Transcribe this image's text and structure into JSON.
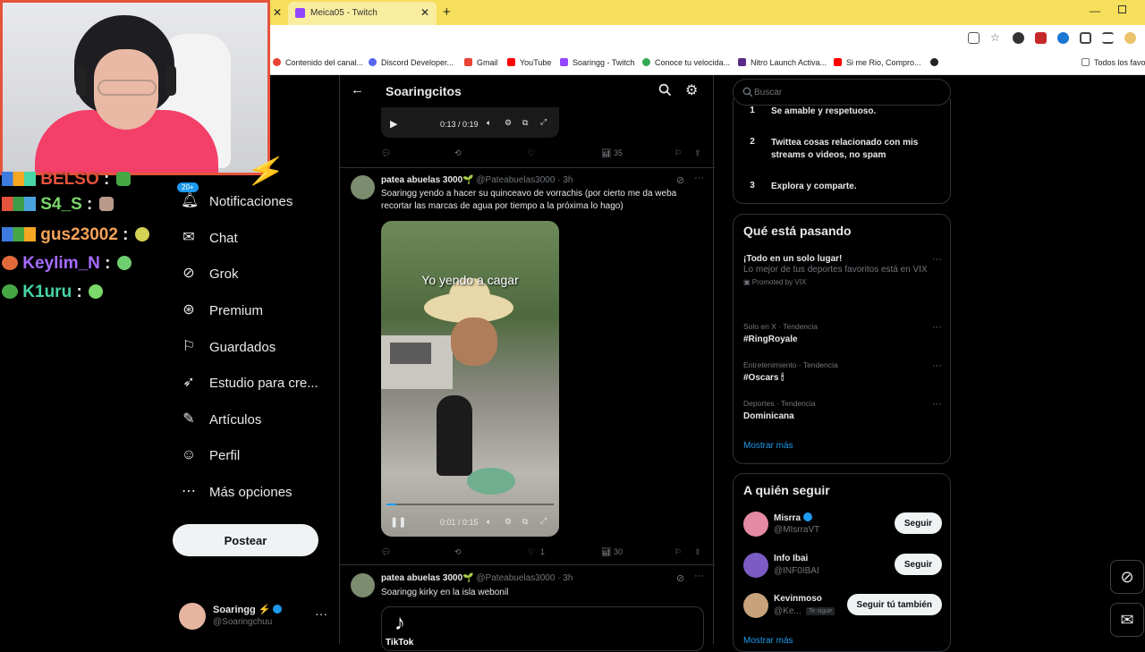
{
  "browser": {
    "tab_title": "Meica05 - Twitch",
    "bookmarks": [
      {
        "label": "Contenido del canal...",
        "color": "#ea4335"
      },
      {
        "label": "Discord Developer...",
        "color": "#5865f2"
      },
      {
        "label": "Gmail",
        "color": "#ea4335"
      },
      {
        "label": "YouTube",
        "color": "#ff0000"
      },
      {
        "label": "Soaringg - Twitch",
        "color": "#9146ff"
      },
      {
        "label": "Conoce tu velocida...",
        "color": "#34a853"
      },
      {
        "label": "Nitro Launch Activa...",
        "color": "#5b2a86"
      },
      {
        "label": "Si me Rio, Compro...",
        "color": "#ff0000"
      },
      {
        "label": "",
        "color": "#222"
      },
      {
        "label": "Todos los favor",
        "color": "#777"
      }
    ]
  },
  "stream_chat": [
    {
      "user": "BELSO",
      "sep": " : ",
      "color": "#e5533c"
    },
    {
      "user": "S4_S",
      "sep": " : ",
      "color": "#7bd86a"
    },
    {
      "user": "gus23002",
      "sep": " : ",
      "color": "#f4a259"
    },
    {
      "user": "Keylim_N",
      "sep": " : ",
      "color": "#a66bff"
    },
    {
      "user": "K1uru",
      "sep": " : ",
      "color": "#46d6a8"
    }
  ],
  "nav": {
    "notif_badge": "20+",
    "items": [
      {
        "label": "Notificaciones",
        "icon": "bell-icon"
      },
      {
        "label": "Chat",
        "icon": "mail-icon"
      },
      {
        "label": "Grok",
        "icon": "grok-icon"
      },
      {
        "label": "Premium",
        "icon": "premium-icon"
      },
      {
        "label": "Guardados",
        "icon": "bookmark-icon"
      },
      {
        "label": "Estudio para cre...",
        "icon": "rocket-icon"
      },
      {
        "label": "Artículos",
        "icon": "article-icon"
      },
      {
        "label": "Perfil",
        "icon": "person-icon"
      },
      {
        "label": "Más opciones",
        "icon": "more-icon"
      }
    ],
    "post_button": "Postear"
  },
  "profile": {
    "name": "Soaringg ⚡",
    "handle": "@Soaringchuu"
  },
  "center": {
    "title": "Soaringcitos",
    "post1_player": {
      "time": "0:13 / 0:19"
    },
    "post1_actions": {
      "views": "35"
    },
    "post2": {
      "name": "patea abuelas 3000🌱",
      "handle": "@Pateabuelas3000 · 3h",
      "text": "Soaringg yendo a hacer su quinceavo de vorrachis (por cierto me da weba recortar las marcas de agua por tiempo a la próxima lo hago)",
      "video_caption": "Yo yendo a cagar",
      "progress": 0.06,
      "time": "0:01 / 0:15",
      "likes": "1",
      "views": "30"
    },
    "post3": {
      "name": "patea abuelas 3000🌱",
      "handle": "@Pateabuelas3000 · 3h",
      "text": "Soaringg kirky en la isla webonil",
      "card_title": "TikTok"
    }
  },
  "right": {
    "search_placeholder": "Buscar",
    "rules": [
      {
        "num": "1",
        "text": "Se amable y respetuoso."
      },
      {
        "num": "2",
        "text": "Twittea cosas relacionado con mis streams o videos, no spam"
      },
      {
        "num": "3",
        "text": "Explora y comparte."
      }
    ],
    "trends_title": "Qué está pasando",
    "trends": [
      {
        "title": "¡Todo en un solo lugar!",
        "desc": "Lo mejor de tus deportes favoritos  está en VIX",
        "promoted": "Promoted by VIX",
        "category": ""
      },
      {
        "category": "Solo en X · Tendencia",
        "title": "#RingRoyale"
      },
      {
        "category": "Entretenimiento · Tendencia",
        "title": "#Oscars 🕯"
      },
      {
        "category": "Deportes · Tendencia",
        "title": "Dominicana"
      }
    ],
    "show_more": "Mostrar más",
    "follow_title": "A quién seguir",
    "follow": [
      {
        "name": "Misrra",
        "handle": "@MIsrraVT",
        "button": "Seguir",
        "color": "#e48aa4",
        "tag": ""
      },
      {
        "name": "Info Ibai",
        "handle": "@INF0IBAI",
        "button": "Seguir",
        "color": "#7b5cc4",
        "tag": ""
      },
      {
        "name": "Kevinmoso",
        "handle": "@Ke...",
        "button": "Seguir tú también",
        "color": "#c8a27a",
        "tag": "Te sigue"
      }
    ],
    "follow_show_more": "Mostrar más"
  }
}
